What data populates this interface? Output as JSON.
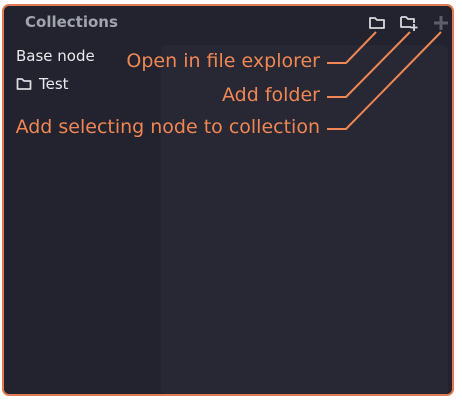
{
  "panel": {
    "title": "Collections",
    "accent_color": "#e07b53",
    "toolbar": {
      "open_in_explorer_icon": "folder-icon",
      "add_folder_icon": "folder-plus-icon",
      "add_node_icon": "plus-icon"
    },
    "tree": [
      {
        "label": "Base node",
        "icon": null
      },
      {
        "label": "Test",
        "icon": "folder-icon"
      }
    ]
  },
  "annotations": {
    "color": "#f08654",
    "items": [
      {
        "label": "Open in file explorer"
      },
      {
        "label": "Add folder"
      },
      {
        "label": "Add selecting node to collection"
      }
    ]
  }
}
